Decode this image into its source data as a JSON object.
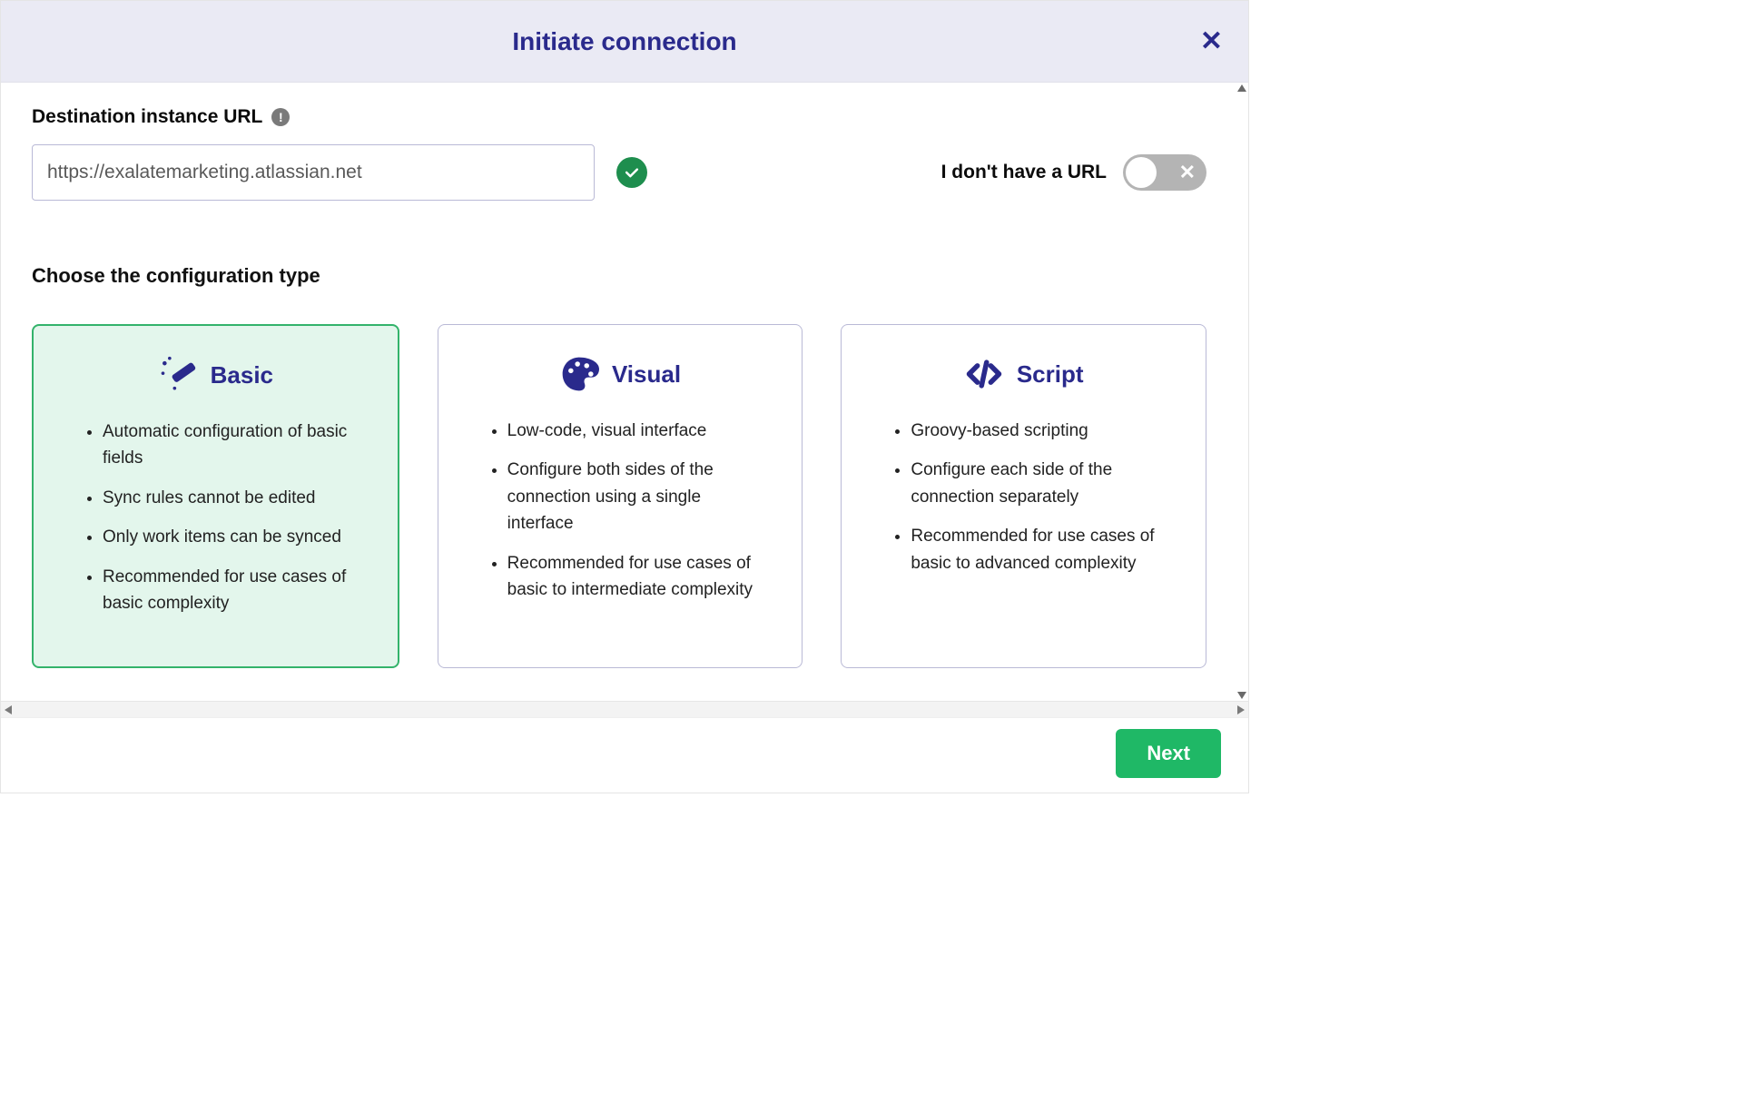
{
  "header": {
    "title": "Initiate connection",
    "close_icon": "✕"
  },
  "url_section": {
    "label": "Destination instance URL",
    "value": "https://exalatemarketing.atlassian.net",
    "validated": true
  },
  "nourl": {
    "label": "I don't have a URL",
    "enabled": false
  },
  "config": {
    "title": "Choose the configuration type"
  },
  "cards": [
    {
      "id": "basic",
      "title": "Basic",
      "selected": true,
      "bullets": [
        "Automatic configuration of basic fields",
        "Sync rules cannot be edited",
        "Only work items can be synced",
        "Recommended for use cases of basic complexity"
      ]
    },
    {
      "id": "visual",
      "title": "Visual",
      "selected": false,
      "bullets": [
        "Low-code, visual interface",
        "Configure both sides of the connection using a single interface",
        "Recommended for use cases of basic to intermediate complexity"
      ]
    },
    {
      "id": "script",
      "title": "Script",
      "selected": false,
      "bullets": [
        "Groovy-based scripting",
        "Configure each side of the connection separately",
        "Recommended for use cases of basic to advanced complexity"
      ]
    }
  ],
  "footer": {
    "next_label": "Next"
  }
}
